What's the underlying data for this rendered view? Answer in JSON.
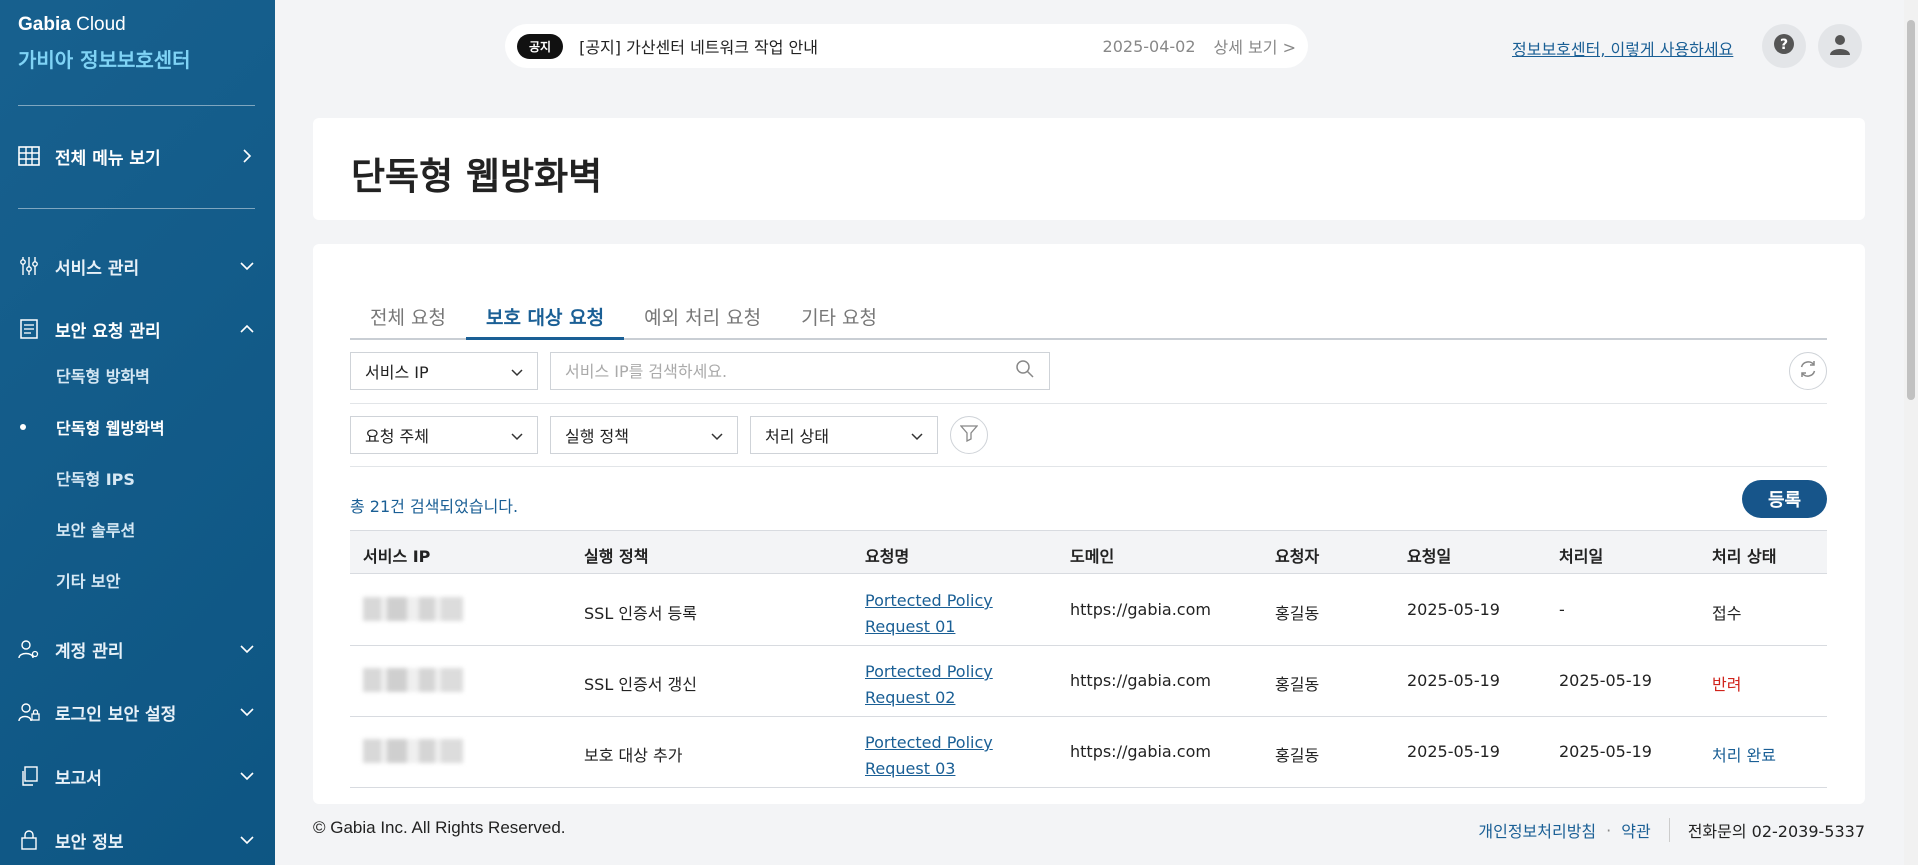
{
  "sidebar": {
    "brand_company": "Gabia",
    "brand_product": " Cloud",
    "brand_title": "가비아 정보보호센터",
    "all_menu": "전체 메뉴 보기",
    "sections": {
      "service": "서비스 관리",
      "security_request": "보안 요청 관리",
      "account": "계정 관리",
      "login_security": "로그인 보안 설정",
      "report": "보고서",
      "security_info": "보안 정보"
    },
    "sub_items": [
      "단독형 방화벽",
      "단독형 웹방화벽",
      "단독형 IPS",
      "보안 솔루션",
      "기타 보안"
    ]
  },
  "notice": {
    "badge": "공지",
    "text": "[공지] 가산센터 네트워크 작업 안내",
    "date": "2025-04-02",
    "more": "상세 보기 >"
  },
  "header": {
    "help_link": "정보보호센터, 이렇게 사용하세요"
  },
  "page": {
    "title": "단독형 웹방화벽"
  },
  "tabs": [
    "전체 요청",
    "보호 대상 요청",
    "예외 처리 요청",
    "기타 요청"
  ],
  "filters": {
    "search_type": "서비스 IP",
    "search_placeholder": "서비스 IP를 검색하세요.",
    "requester_type": "요청 주체",
    "policy": "실행 정책",
    "status": "처리 상태"
  },
  "result_count": "총 21건 검색되었습니다.",
  "register_button": "등록",
  "table": {
    "headers": [
      "서비스 IP",
      "실행 정책",
      "요청명",
      "도메인",
      "요청자",
      "요청일",
      "처리일",
      "처리 상태"
    ],
    "rows": [
      {
        "policy": "SSL 인증서 등록",
        "name_line1": "Portected Policy",
        "name_line2": "Request 01",
        "domain": "https://gabia.com",
        "requester": "홍길동",
        "request_date": "2025-05-19",
        "process_date": "-",
        "status": "접수"
      },
      {
        "policy": "SSL 인증서 갱신",
        "name_line1": "Portected Policy",
        "name_line2": "Request 02",
        "domain": "https://gabia.com",
        "requester": "홍길동",
        "request_date": "2025-05-19",
        "process_date": "2025-05-19",
        "status": "반려"
      },
      {
        "policy": "보호 대상 추가",
        "name_line1": "Portected Policy",
        "name_line2": "Request 03",
        "domain": "https://gabia.com",
        "requester": "홍길동",
        "request_date": "2025-05-19",
        "process_date": "2025-05-19",
        "status": "처리 완료"
      }
    ]
  },
  "footer": {
    "copyright": "© Gabia Inc. All Rights Reserved.",
    "privacy": "개인정보처리방침",
    "terms": "약관",
    "phone": "전화문의 02-2039-5337"
  },
  "colors": {
    "sidebar_bg": "#0e5a8a",
    "accent": "#1a5f95",
    "rejected": "#d0241c"
  }
}
